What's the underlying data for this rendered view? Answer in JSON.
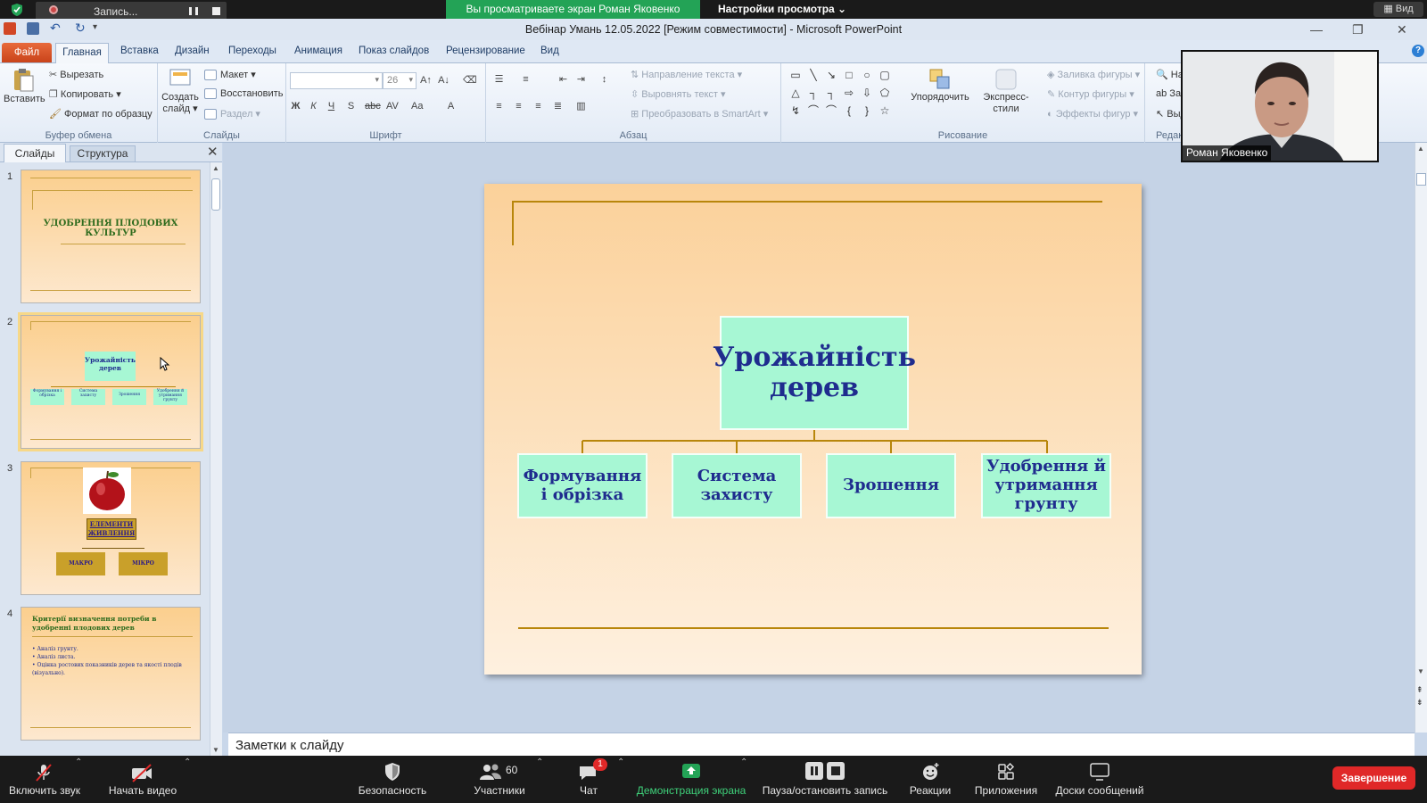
{
  "zoom_top": {
    "recording_label": "Запись...",
    "share_banner": "Вы просматриваете экран Роман Яковенко",
    "view_options": "Настройки просмотра",
    "view_button": "Вид"
  },
  "app": {
    "title": "Вебінар Умань 12.05.2022 [Режим совместимости]  -  Microsoft PowerPoint"
  },
  "tabs": [
    "Файл",
    "Главная",
    "Вставка",
    "Дизайн",
    "Переходы",
    "Анимация",
    "Показ слайдов",
    "Рецензирование",
    "Вид"
  ],
  "ribbon": {
    "clipboard": {
      "label": "Буфер обмена",
      "paste": "Вставить",
      "cut": "Вырезать",
      "copy": "Копировать",
      "format_painter": "Формат по образцу"
    },
    "slides": {
      "label": "Слайды",
      "new_slide": "Создать",
      "new_slide2": "слайд",
      "layout": "Макет",
      "reset": "Восстановить",
      "section": "Раздел"
    },
    "font": {
      "label": "Шрифт",
      "size": "26"
    },
    "paragraph": {
      "label": "Абзац",
      "text_direction": "Направление текста",
      "align_text": "Выровнять текст",
      "smartart": "Преобразовать в SmartArt"
    },
    "drawing": {
      "label": "Рисование",
      "arrange": "Упорядочить",
      "quick_styles": "Экспресс-стили",
      "shape_fill": "Заливка фигуры",
      "shape_outline": "Контур фигуры",
      "shape_effects": "Эффекты фигур"
    },
    "editing": {
      "label": "Редактирова",
      "find": "Найти",
      "replace": "Замени",
      "select": "Выдели"
    }
  },
  "pane": {
    "slides_tab": "Слайды",
    "outline_tab": "Структура"
  },
  "thumbnails": [
    {
      "num": "1",
      "title": "УДОБРЕННЯ  ПЛОДОВИХ КУЛЬТУР"
    },
    {
      "num": "2",
      "root": "Урожайність дерев",
      "children": [
        "Формування і обрізка",
        "Система захисту",
        "Зрошення",
        "Удобрення й утримання грунту"
      ]
    },
    {
      "num": "3",
      "title": "ЕЛЕМЕНТИ ЖИВЛЕННЯ",
      "left": "МАКРО",
      "right": "МІКРО"
    },
    {
      "num": "4",
      "title": "Критерії визначення потреби в удобренні плодових дерев",
      "bullets": [
        "Аналіз грунту.",
        "Аналіз листа.",
        "Оцінка ростових показників дерев та якості плодів (візуально)."
      ]
    }
  ],
  "slide": {
    "root_line1": "Урожайність",
    "root_line2": "дерев",
    "children": [
      {
        "l1": "Формування",
        "l2": "і обрізка",
        "l3": ""
      },
      {
        "l1": "Система",
        "l2": "захисту",
        "l3": ""
      },
      {
        "l1": "Зрошення",
        "l2": "",
        "l3": ""
      },
      {
        "l1": "Удобрення й",
        "l2": "утримання",
        "l3": "грунту"
      }
    ]
  },
  "notes_placeholder": "Заметки к слайду",
  "webcam": {
    "name": "Роман Яковенко"
  },
  "zoom_bottom": {
    "unmute": "Включить звук",
    "start_video": "Начать видео",
    "security": "Безопасность",
    "participants": "Участники",
    "participants_count": "60",
    "chat": "Чат",
    "chat_badge": "1",
    "share": "Демонстрация экрана",
    "pause_record": "Пауза/остановить запись",
    "reactions": "Реакции",
    "apps": "Приложения",
    "whiteboards": "Доски сообщений",
    "end": "Завершение"
  },
  "colors": {
    "share_green": "#23a356",
    "node_fill": "#a7f7d4",
    "node_text": "#1f2c8e",
    "connector": "#b8860b",
    "end_red": "#e02828"
  }
}
